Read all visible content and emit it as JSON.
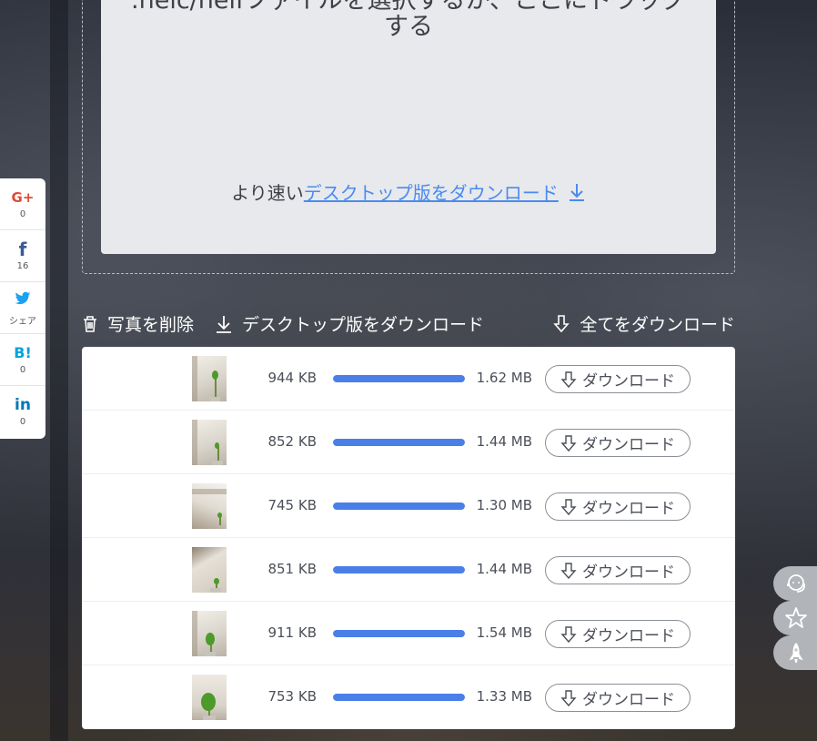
{
  "upload": {
    "instruction_line1": ".heic/heifファイルを選択するか、ここにドラッグ",
    "instruction_line2": "する",
    "faster_prefix": "より速い",
    "desktop_link": "デスクトップ版をダウンロード"
  },
  "actions": {
    "delete_label": "写真を削除",
    "desktop_label": "デスクトップ版をダウンロード",
    "download_all_label": "全てをダウンロード"
  },
  "files": [
    {
      "original_size": "944 KB",
      "converted_size": "1.62 MB",
      "progress": 1.0,
      "button": "ダウンロード"
    },
    {
      "original_size": "852 KB",
      "converted_size": "1.44 MB",
      "progress": 1.0,
      "button": "ダウンロード"
    },
    {
      "original_size": "745 KB",
      "converted_size": "1.30 MB",
      "progress": 1.0,
      "button": "ダウンロード"
    },
    {
      "original_size": "851 KB",
      "converted_size": "1.44 MB",
      "progress": 1.0,
      "button": "ダウンロード"
    },
    {
      "original_size": "911 KB",
      "converted_size": "1.54 MB",
      "progress": 1.0,
      "button": "ダウンロード"
    },
    {
      "original_size": "753 KB",
      "converted_size": "1.33 MB",
      "progress": 1.0,
      "button": "ダウンロード"
    }
  ],
  "social": [
    {
      "icon": "google-plus-icon",
      "label": "G+",
      "count": "0",
      "color": "#dd4b39"
    },
    {
      "icon": "facebook-icon",
      "label": "f",
      "count": "16",
      "color": "#3b5998"
    },
    {
      "icon": "twitter-icon",
      "label": "🐦",
      "count": "シェア",
      "color": "#1da1f2"
    },
    {
      "icon": "hatena-bookmark-icon",
      "label": "B!",
      "count": "0",
      "color": "#00a4de"
    },
    {
      "icon": "linkedin-icon",
      "label": "in",
      "count": "0",
      "color": "#0077b5"
    }
  ],
  "floating": [
    {
      "icon": "support-headset-icon"
    },
    {
      "icon": "star-icon"
    },
    {
      "icon": "rocket-icon"
    }
  ],
  "colors": {
    "accent": "#4a7fe8",
    "link": "#4a8bf0"
  }
}
